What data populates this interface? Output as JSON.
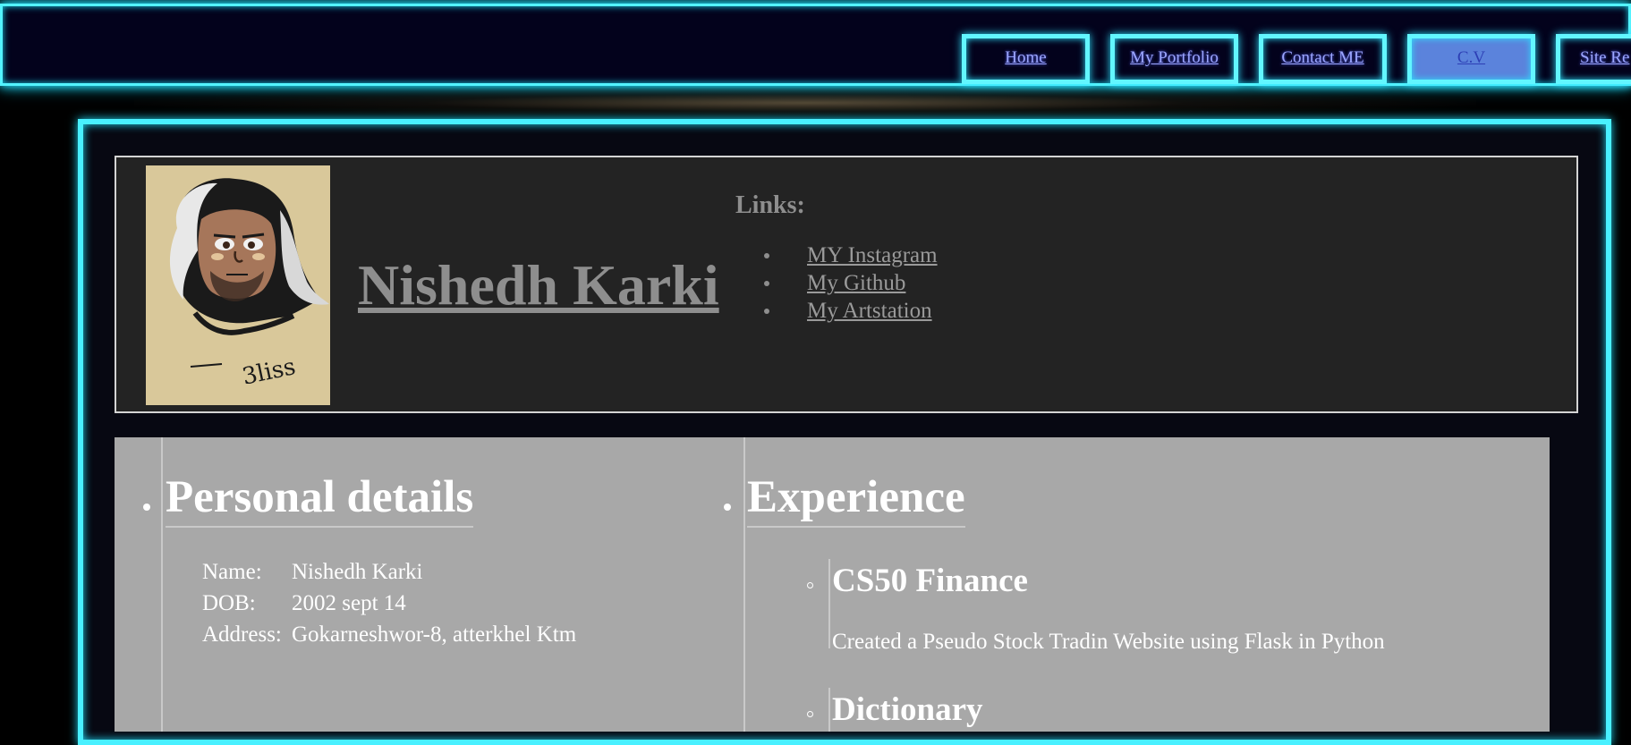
{
  "nav": {
    "items": [
      {
        "label": "Home",
        "active": false
      },
      {
        "label": "My Portfolio",
        "active": false
      },
      {
        "label": "Contact ME",
        "active": false
      },
      {
        "label": "C.V",
        "active": true
      },
      {
        "label": "Site Re",
        "active": false
      }
    ]
  },
  "header": {
    "name": "Nishedh Karki",
    "avatar_icon": "avatar-drawing-icon",
    "links_heading": "Links:",
    "links": [
      {
        "label": "MY Instagram"
      },
      {
        "label": "My Github"
      },
      {
        "label": "My Artstation"
      }
    ]
  },
  "personal": {
    "heading": "Personal details",
    "rows": [
      {
        "key": "Name:",
        "value": "Nishedh Karki"
      },
      {
        "key": "DOB:",
        "value": "2002 sept 14"
      },
      {
        "key": "Address:",
        "value": "Gokarneshwor-8, atterkhel Ktm"
      }
    ]
  },
  "experience": {
    "heading": "Experience",
    "items": [
      {
        "title": "CS50 Finance",
        "description": "Created a Pseudo Stock Tradin Website using Flask in Python"
      },
      {
        "title": "Dictionary",
        "description": ""
      }
    ]
  },
  "colors": {
    "accent": "#49f0ff",
    "nav_bg": "#03021c",
    "active_tab": "#5b83dc",
    "panel_bg": "#a8a8a8",
    "card_bg": "#232323"
  }
}
